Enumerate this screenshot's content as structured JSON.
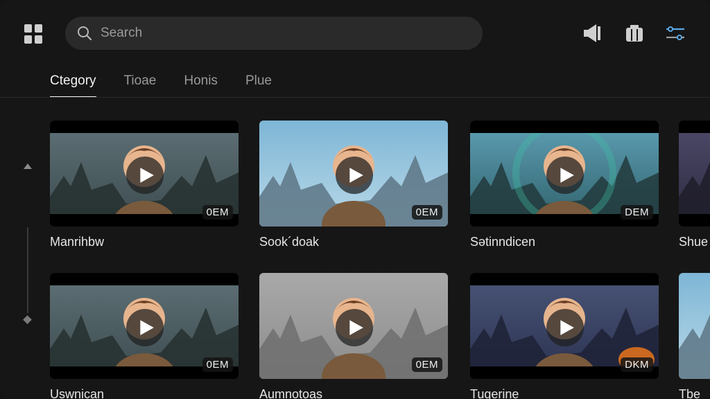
{
  "search": {
    "placeholder": "Search"
  },
  "tabs": [
    {
      "label": "Ctegory",
      "active": true
    },
    {
      "label": "Tioae",
      "active": false
    },
    {
      "label": "Honis",
      "active": false
    },
    {
      "label": "Plue",
      "active": false
    }
  ],
  "header_icons": [
    "grid-icon",
    "search-icon",
    "speaker-icon",
    "library-icon",
    "sliders-icon"
  ],
  "cards": [
    {
      "title": "Manrihbw",
      "badge": "0EM",
      "scene": "dark-ruins"
    },
    {
      "title": "Sook´doak",
      "badge": "0EM",
      "scene": "blue-sky"
    },
    {
      "title": "Sətinndicen",
      "badge": "DEM",
      "scene": "portal"
    },
    {
      "title": "Shue",
      "badge": "",
      "scene": "dusk-city"
    },
    {
      "title": "Uswnican",
      "badge": "0EM",
      "scene": "dark-ruins"
    },
    {
      "title": "Aumnotoas",
      "badge": "0EM",
      "scene": "grey-mist"
    },
    {
      "title": "Tugerine",
      "badge": "DKM",
      "scene": "fire-city"
    },
    {
      "title": "Tbe",
      "badge": "",
      "scene": "blue-sky"
    }
  ],
  "colors": {
    "accent": "#5aa8e6",
    "background": "#161616",
    "search_bg": "#2a2a2a"
  }
}
